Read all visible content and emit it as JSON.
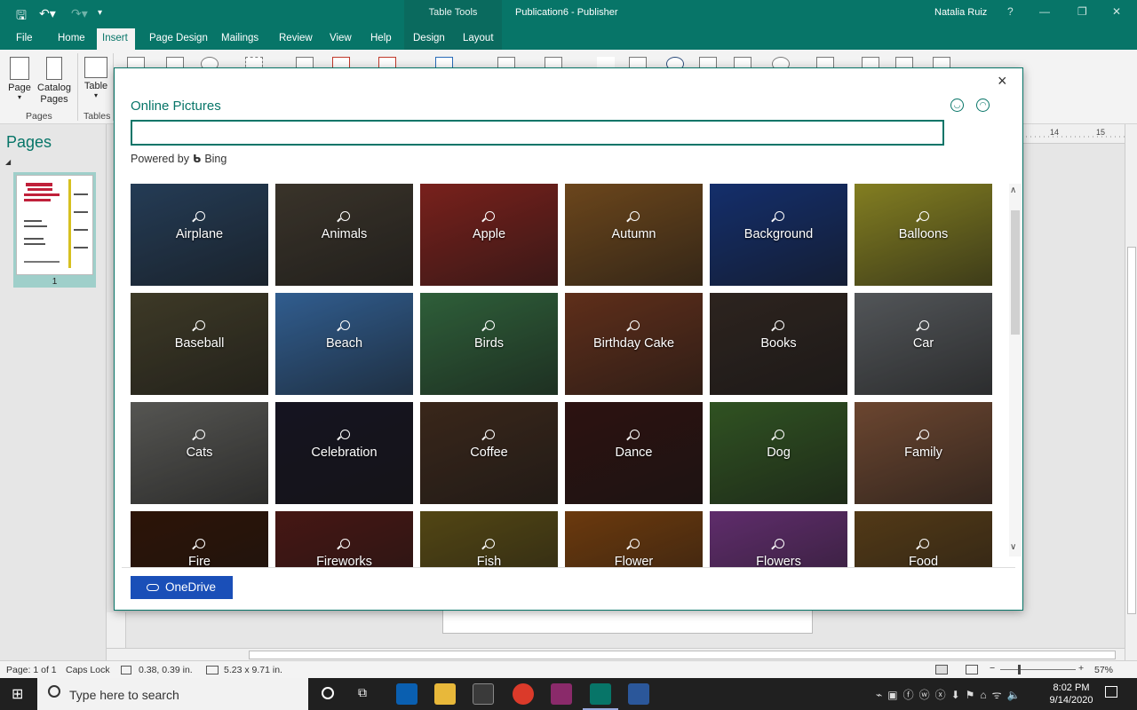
{
  "app": {
    "context_group": "Table Tools",
    "doc_title": "Publication6  -  Publisher",
    "user": "Natalia Ruiz",
    "help_glyph": "?",
    "accent": "#077568"
  },
  "ribbon_tabs": [
    "File",
    "Home",
    "Insert",
    "Page Design",
    "Mailings",
    "Review",
    "View",
    "Help",
    "Design",
    "Layout"
  ],
  "active_tab": "Insert",
  "ribbon": {
    "page_label": "Page",
    "catalog_pages_label": "Catalog\nPages",
    "table_label": "Table",
    "group_pages": "Pages",
    "group_tables": "Tables"
  },
  "pages_pane": {
    "title": "Pages",
    "page_number": "1"
  },
  "dialog": {
    "title": "Online Pictures",
    "search_value": "",
    "powered_by": "Powered by",
    "bing": "Bing",
    "onedrive_label": "OneDrive",
    "close_glyph": "×",
    "tiles": [
      {
        "label": "Airplane",
        "color": "#2f4d6e"
      },
      {
        "label": "Animals",
        "color": "#4a4236"
      },
      {
        "label": "Apple",
        "color": "#9b2a24"
      },
      {
        "label": "Autumn",
        "color": "#8a5a24"
      },
      {
        "label": "Background",
        "color": "#1a3c8a"
      },
      {
        "label": "Balloons",
        "color": "#a8a22b"
      },
      {
        "label": "Baseball",
        "color": "#4f4a32"
      },
      {
        "label": "Beach",
        "color": "#3f78b8"
      },
      {
        "label": "Birds",
        "color": "#3c7a4a"
      },
      {
        "label": "Birthday Cake",
        "color": "#7a3c22"
      },
      {
        "label": "Books",
        "color": "#3a2e28"
      },
      {
        "label": "Car",
        "color": "#6a6e72"
      },
      {
        "label": "Cats",
        "color": "#6e6e6a"
      },
      {
        "label": "Celebration",
        "color": "#1c1a2a"
      },
      {
        "label": "Coffee",
        "color": "#4a3222"
      },
      {
        "label": "Dance",
        "color": "#3a1816"
      },
      {
        "label": "Dog",
        "color": "#3e6a2c"
      },
      {
        "label": "Family",
        "color": "#8a5a3e"
      },
      {
        "label": "Fire",
        "color": "#3a1a0a"
      },
      {
        "label": "Fireworks",
        "color": "#5a1e1a"
      },
      {
        "label": "Fish",
        "color": "#6a5a1a"
      },
      {
        "label": "Flower",
        "color": "#8a4a12"
      },
      {
        "label": "Flowers",
        "color": "#7a3a8a"
      },
      {
        "label": "Food",
        "color": "#6a4a1e"
      }
    ]
  },
  "status": {
    "page": "Page: 1 of 1",
    "caps": "Caps Lock",
    "position": "0.38, 0.39 in.",
    "size": "5.23 x 9.71 in.",
    "zoom": "57%"
  },
  "taskbar": {
    "search_placeholder": "Type here to search",
    "time": "8:02 PM",
    "date": "9/14/2020"
  }
}
